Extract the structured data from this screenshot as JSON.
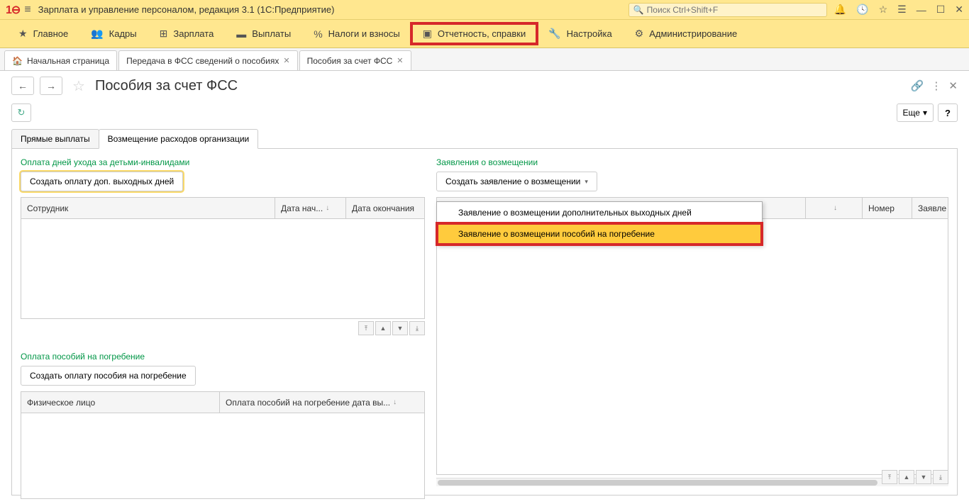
{
  "titlebar": {
    "app_title": "Зарплата и управление персоналом, редакция 3.1  (1С:Предприятие)",
    "search_placeholder": "Поиск Ctrl+Shift+F"
  },
  "mainmenu": {
    "items": [
      {
        "label": "Главное",
        "icon": "★"
      },
      {
        "label": "Кадры",
        "icon": "👥"
      },
      {
        "label": "Зарплата",
        "icon": "⊞"
      },
      {
        "label": "Выплаты",
        "icon": "💳"
      },
      {
        "label": "Налоги и взносы",
        "icon": "%"
      },
      {
        "label": "Отчетность, справки",
        "icon": "📋",
        "highlighted": true
      },
      {
        "label": "Настройка",
        "icon": "🔧"
      },
      {
        "label": "Администрирование",
        "icon": "⚙"
      }
    ]
  },
  "tabs": [
    {
      "label": "Начальная страница",
      "home": true
    },
    {
      "label": "Передача в ФСС сведений о пособиях",
      "closable": true
    },
    {
      "label": "Пособия за счет ФСС",
      "closable": true,
      "active": true
    }
  ],
  "page": {
    "title": "Пособия за счет ФСС",
    "more_btn": "Еще"
  },
  "subtabs": [
    {
      "label": "Прямые выплаты"
    },
    {
      "label": "Возмещение расходов организации",
      "active": true
    }
  ],
  "left": {
    "section1_label": "Оплата дней ухода за детьми-инвалидами",
    "section1_btn": "Создать оплату доп. выходных дней",
    "tbl1_cols": [
      "Сотрудник",
      "Дата нач...",
      "Дата окончания"
    ],
    "section2_label": "Оплата пособий на погребение",
    "section2_btn": "Создать оплату пособия на погребение",
    "tbl2_cols": [
      "Физическое лицо",
      "Оплата пособий на погребение дата вы..."
    ]
  },
  "right": {
    "section_label": "Заявления о возмещении",
    "btn": "Создать заявление о возмещении",
    "dropdown": [
      "Заявление о возмещении дополнительных выходных дней",
      "Заявление о возмещении пособий на погребение"
    ],
    "tbl_cols": [
      "",
      "↓",
      "Номер",
      "Заявле"
    ]
  }
}
